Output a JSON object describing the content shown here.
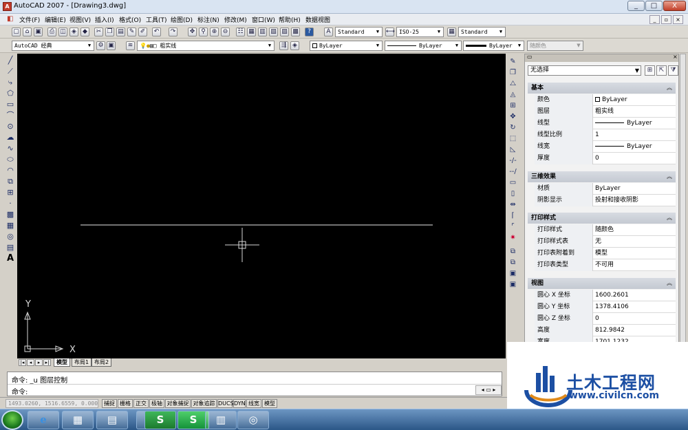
{
  "window": {
    "app_icon": "A",
    "title": "AutoCAD 2007 - [Drawing3.dwg]",
    "min_label": "_",
    "max_label": "□",
    "close_label": "X",
    "doc_min": "_",
    "doc_max": "▫",
    "doc_close": "×"
  },
  "menu": [
    "文件(F)",
    "编辑(E)",
    "视图(V)",
    "插入(I)",
    "格式(O)",
    "工具(T)",
    "绘图(D)",
    "标注(N)",
    "修改(M)",
    "窗口(W)",
    "帮助(H)",
    "数据视图"
  ],
  "toolbar1": {
    "text_style": "Standard",
    "dim_style": "ISO-25",
    "table_style": "Standard"
  },
  "toolbar2": {
    "workspace": "AutoCAD 经典",
    "layer": "粗实线",
    "color": "ByLayer",
    "linetype": "ByLayer",
    "lineweight": "ByLayer",
    "plotstyle": "随颜色"
  },
  "tabs": [
    "模型",
    "布局1",
    "布局2"
  ],
  "canvas": {
    "ucs_y": "Y",
    "ucs_x": "X"
  },
  "command": {
    "line1": "命令: _u 图层控制",
    "line2": "命令:"
  },
  "status": {
    "coords": "1493.0260, 1516.6559, 0.0000",
    "buttons": [
      "捕捉",
      "栅格",
      "正交",
      "极轴",
      "对象捕捉",
      "对象追踪",
      "DUCS",
      "DYN",
      "线宽",
      "模型"
    ]
  },
  "properties": {
    "selection": "无选择",
    "sections": [
      {
        "title": "基本",
        "rows": [
          {
            "name": "颜色",
            "value": "ByLayer"
          },
          {
            "name": "图层",
            "value": "粗实线"
          },
          {
            "name": "线型",
            "value": "ByLayer"
          },
          {
            "name": "线型比例",
            "value": "1"
          },
          {
            "name": "线宽",
            "value": "ByLayer"
          },
          {
            "name": "厚度",
            "value": "0"
          }
        ]
      },
      {
        "title": "三维效果",
        "rows": [
          {
            "name": "材质",
            "value": "ByLayer"
          },
          {
            "name": "阴影显示",
            "value": "投射和接收阴影"
          }
        ]
      },
      {
        "title": "打印样式",
        "rows": [
          {
            "name": "打印样式",
            "value": "随颜色"
          },
          {
            "name": "打印样式表",
            "value": "无"
          },
          {
            "name": "打印表附着到",
            "value": "模型"
          },
          {
            "name": "打印表类型",
            "value": "不可用"
          }
        ]
      },
      {
        "title": "视图",
        "rows": [
          {
            "name": "圆心 X 坐标",
            "value": "1600.2601"
          },
          {
            "name": "圆心 Y 坐标",
            "value": "1378.4106"
          },
          {
            "name": "圆心 Z 坐标",
            "value": "0"
          },
          {
            "name": "高度",
            "value": "812.9842"
          },
          {
            "name": "宽度",
            "value": "1701.1232"
          }
        ]
      }
    ]
  },
  "watermark": {
    "title": "土木工程网",
    "url": "www.civilcn.com"
  },
  "taskbar": {
    "apps": [
      "e",
      "▦",
      "▤",
      "A",
      "S",
      "▥",
      "◎"
    ]
  }
}
